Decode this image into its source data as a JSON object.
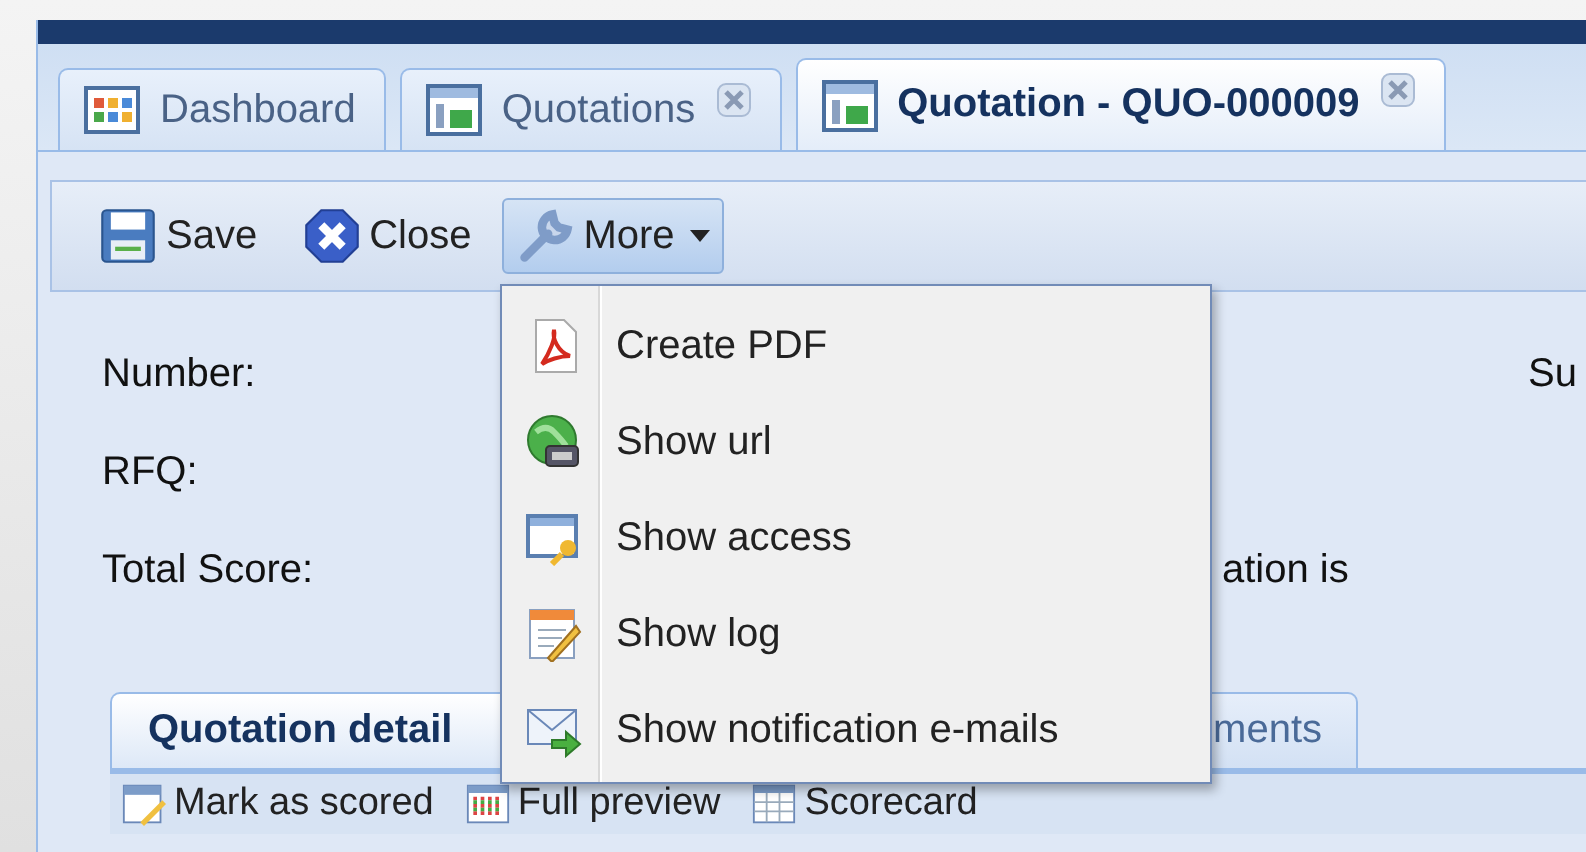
{
  "tabs": [
    {
      "label": "Dashboard",
      "kind": "dashboard",
      "selected": false,
      "closable": false
    },
    {
      "label": "Quotations",
      "kind": "list",
      "selected": false,
      "closable": true
    },
    {
      "label": "Quotation - QUO-000009",
      "kind": "list",
      "selected": true,
      "closable": true
    }
  ],
  "toolbar": [
    {
      "label": "Save",
      "kind": "save",
      "pressed": false
    },
    {
      "label": "Close",
      "kind": "close",
      "pressed": false
    },
    {
      "label": "More",
      "kind": "more",
      "pressed": true
    }
  ],
  "menu": [
    {
      "label": "Create PDF",
      "kind": "pdf"
    },
    {
      "label": "Show url",
      "kind": "globe"
    },
    {
      "label": "Show access",
      "kind": "key"
    },
    {
      "label": "Show log",
      "kind": "log"
    },
    {
      "label": "Show notification e-mails",
      "kind": "mail"
    }
  ],
  "fields": [
    {
      "label": "Number:",
      "column_3": "Su"
    },
    {
      "label": "RFQ:"
    },
    {
      "label": "Total Score:",
      "column_2": "ation is"
    }
  ],
  "subtabs": [
    {
      "label": "Quotation detail",
      "selected": true
    },
    {
      "label": "ments",
      "selected": false
    }
  ],
  "bottom_toolbar": [
    {
      "label": "Mark as scored",
      "kind": "mark"
    },
    {
      "label": "Full preview",
      "kind": "preview"
    },
    {
      "label": "Scorecard",
      "kind": "scorecard"
    }
  ]
}
